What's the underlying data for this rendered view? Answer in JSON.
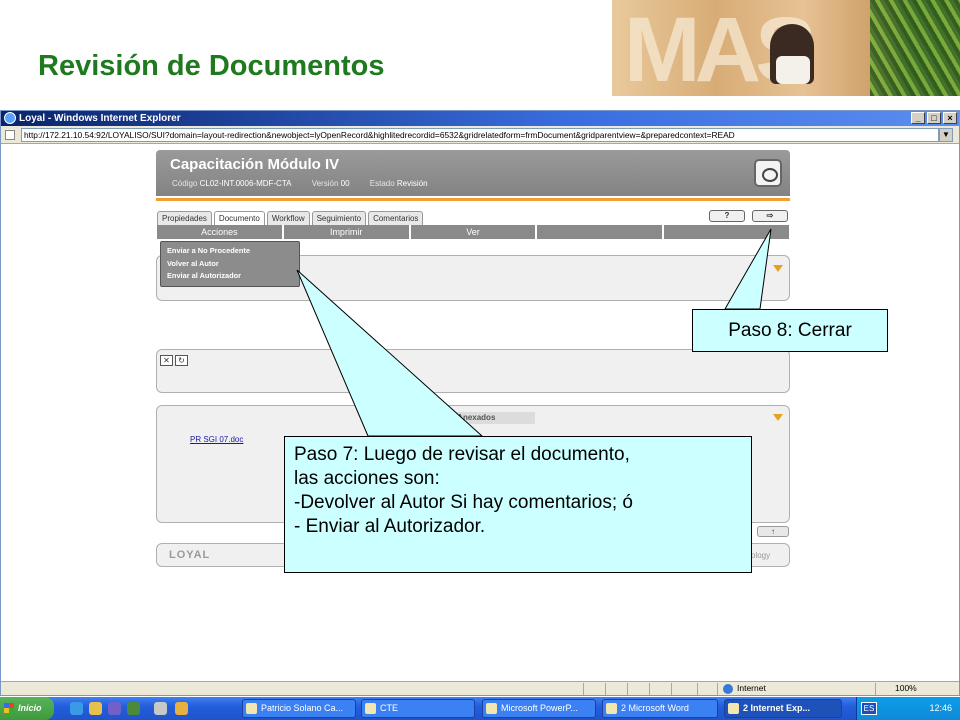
{
  "slide": {
    "title": "Revisión de Documentos",
    "logo_text": "MAS"
  },
  "browser": {
    "window_title": "Loyal - Windows Internet Explorer",
    "url": "http://172.21.10.54:92/LOYALISO/SUI?domain=layout-redirection&newobject=lyOpenRecord&highlitedrecordid=6532&gridrelatedform=frmDocument&gridparentview=&preparedcontext=READ",
    "status_zone": "Internet",
    "zoom": "100%"
  },
  "app": {
    "doc_title": "Capacitación Módulo IV",
    "codigo_label": "Código",
    "codigo_value": "CL02-INT.0006-MDF-CTA",
    "version_label": "Versión",
    "version_value": "00",
    "estado_label": "Estado",
    "estado_value": "Revisión",
    "tabs": [
      "Propiedades",
      "Documento",
      "Workflow",
      "Seguimiento",
      "Comentarios"
    ],
    "help_button": "?",
    "exit_button": "⇨",
    "actions": [
      "Acciones",
      "Imprimir",
      "Ver",
      "",
      ""
    ],
    "dropdown_items": [
      "Enviar a No Procedente",
      "Volver al Autor",
      "Enviar al Autorizador"
    ],
    "attachments_header": "Archivos Anexados",
    "attachment_file": "PR SGI 07.doc",
    "footer_logo": "LOYAL",
    "footer_right": "ology"
  },
  "callouts": {
    "step8": "Paso 8: Cerrar",
    "step7_lines": [
      "Paso 7: Luego de revisar el documento,",
      "las acciones son:",
      "-Devolver al Autor Si hay comentarios; ó",
      "- Enviar al Autorizador."
    ]
  },
  "taskbar": {
    "start_label": "Inicio",
    "tasks": [
      "Patricio Solano Ca...",
      "CTE",
      "Microsoft PowerP...",
      "2 Microsoft Word",
      "2 Internet Exp..."
    ],
    "language": "ES",
    "clock": "12:46"
  }
}
